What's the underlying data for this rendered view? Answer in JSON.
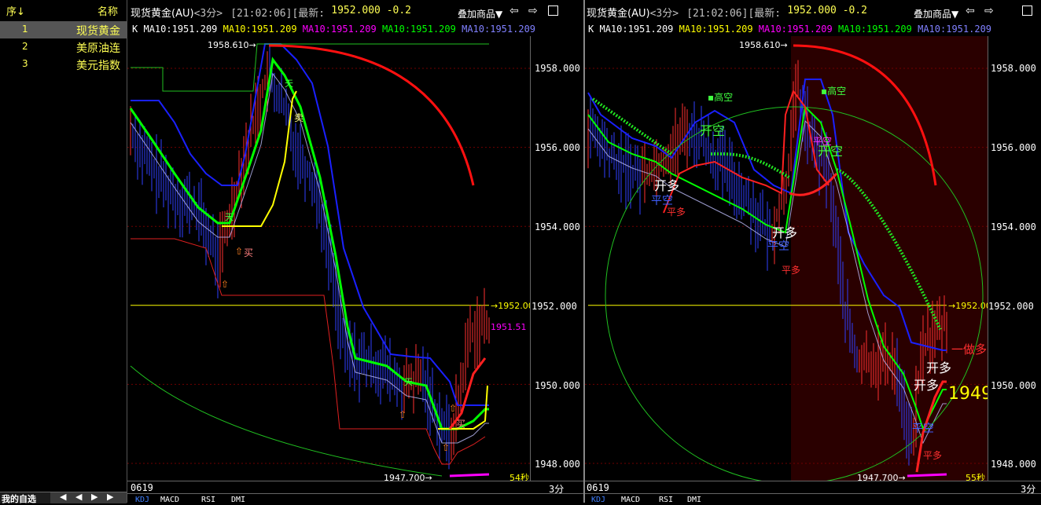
{
  "watchlist": {
    "col_seq": "序↓",
    "col_name": "名称",
    "items": [
      {
        "idx": "1",
        "name": "现货黄金"
      },
      {
        "idx": "2",
        "name": "美原油连"
      },
      {
        "idx": "3",
        "name": "美元指数"
      }
    ],
    "bottom_tab": "我的自选"
  },
  "panels": [
    {
      "title": "现货黄金(AU)",
      "period": "<3分>",
      "time": "[21:02:06]",
      "latest_label": "[最新:",
      "latest_value": "1952.000 -0.2",
      "overlay": "叠加商品▼",
      "ma_k": "K",
      "ma": [
        "MA10:1951.209",
        "MA10:1951.209",
        "MA10:1951.209",
        "MA10:1951.209",
        "MA10:1951.209"
      ],
      "yticks": [
        "1958.000",
        "1956.000",
        "1954.000",
        "1952.000",
        "1950.000",
        "1948.000"
      ],
      "high_label": "1958.610",
      "low_label": "1947.700",
      "price_line_label": "1952.00",
      "price_line_axis": "1952.000",
      "last_label": "1951.51",
      "countdown": "54秒",
      "date": "0619",
      "period_short": "3分",
      "subtabs": [
        "KDJ",
        "MACD",
        "RSI",
        "DMI"
      ],
      "annotations": {
        "buy": "买",
        "sell": "卖",
        "tian": "天",
        "di": "地"
      }
    },
    {
      "title": "现货黄金(AU)",
      "period": "<3分>",
      "time": "[21:02:06]",
      "latest_label": "[最新:",
      "latest_value": "1952.000 -0.2",
      "overlay": "叠加商品▼",
      "ma_k": "K",
      "ma": [
        "MA10:1951.209",
        "MA10:1951.209",
        "MA10:1951.209",
        "MA10:1951.209",
        "MA10:1951.209"
      ],
      "yticks": [
        "1958.000",
        "1956.000",
        "1954.000",
        "1952.000",
        "1950.000",
        "1948.000"
      ],
      "high_label": "1958.610",
      "low_label": "1947.700",
      "price_line_label": "1952.00",
      "price_line_axis": "1952.000",
      "countdown": "55秒",
      "date": "0619",
      "period_short": "3分",
      "subtabs": [
        "KDJ",
        "MACD",
        "RSI",
        "DMI"
      ],
      "annotations": {
        "gaokong": "高空",
        "kaikong": "开空",
        "kaiduo": "开多",
        "pingkong": "平空",
        "pingduo": "平多",
        "yizuoduo": "一做多",
        "big_price": "1949"
      }
    }
  ],
  "colors": {
    "bg": "#000000",
    "up_red": "#ff2020",
    "down_blue": "#2020ff",
    "ma_green": "#00ff00",
    "yellow": "#ffff00",
    "magenta": "#ff00ff",
    "grid": "#800000"
  }
}
